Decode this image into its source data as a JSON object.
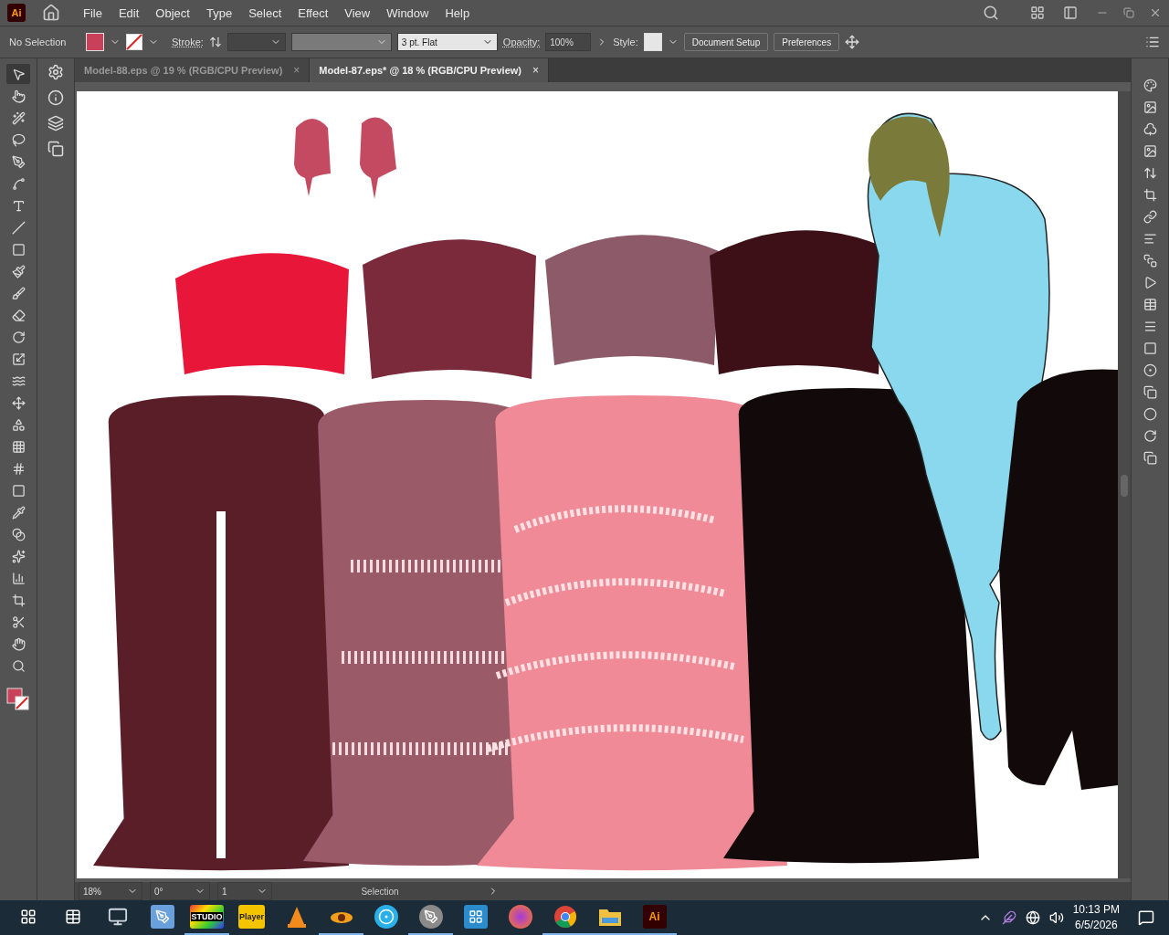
{
  "app": {
    "logo": "Ai"
  },
  "menu": [
    "File",
    "Edit",
    "Object",
    "Type",
    "Select",
    "Effect",
    "View",
    "Window",
    "Help"
  ],
  "control_bar": {
    "selection": "No Selection",
    "fill": {
      "color": "#c8405a"
    },
    "stroke_label": "Stroke:",
    "brush": "3 pt. Flat",
    "opacity_label": "Opacity:",
    "opacity": "100%",
    "style_label": "Style:",
    "buttons": [
      "Document Setup",
      "Preferences"
    ]
  },
  "tools": [
    {
      "kind": "select",
      "selected": true
    },
    {
      "kind": "direct",
      "selected": false
    },
    {
      "kind": "wand",
      "selected": false
    },
    {
      "kind": "lasso",
      "selected": false
    },
    {
      "kind": "pen",
      "selected": false
    },
    {
      "kind": "curve",
      "selected": false
    },
    {
      "kind": "type",
      "selected": false
    },
    {
      "kind": "line",
      "selected": false
    },
    {
      "kind": "rect",
      "selected": false
    },
    {
      "kind": "brush",
      "selected": false
    },
    {
      "kind": "blob",
      "selected": false
    },
    {
      "kind": "eraser",
      "selected": false
    },
    {
      "kind": "rotate",
      "selected": false
    },
    {
      "kind": "scale",
      "selected": false
    },
    {
      "kind": "warp",
      "selected": false
    },
    {
      "kind": "transform",
      "selected": false
    },
    {
      "kind": "shape",
      "selected": false
    },
    {
      "kind": "perspective",
      "selected": false
    },
    {
      "kind": "mesh",
      "selected": false
    },
    {
      "kind": "gradient",
      "selected": false
    },
    {
      "kind": "eyedropper",
      "selected": false
    },
    {
      "kind": "blend",
      "selected": false
    },
    {
      "kind": "symbol",
      "selected": false
    },
    {
      "kind": "graph",
      "selected": false
    },
    {
      "kind": "artboard",
      "selected": false
    },
    {
      "kind": "slice",
      "selected": false
    },
    {
      "kind": "hand",
      "selected": false
    },
    {
      "kind": "zoom",
      "selected": false
    }
  ],
  "tabs": [
    {
      "label": "Model-88.eps @ 19 % (RGB/CPU Preview)",
      "close": "×",
      "selected": false
    },
    {
      "label": "Model-87.eps* @ 18 % (RGB/CPU Preview)",
      "close": "×",
      "selected": true
    }
  ],
  "status_bar": {
    "zoom": "18%",
    "rotation": "0°",
    "artboard": "1",
    "tool": "Selection"
  },
  "taskbar": {
    "apps": [
      {
        "kind": "monitor",
        "open": false
      },
      {
        "kind": "tablet",
        "open": false
      },
      {
        "kind": "studio",
        "label": "STUDIO",
        "open": true
      },
      {
        "kind": "player",
        "label": "Player",
        "open": false
      },
      {
        "kind": "cone",
        "open": false
      },
      {
        "kind": "eye",
        "open": true
      },
      {
        "kind": "reel",
        "open": false
      },
      {
        "kind": "gimp",
        "open": true
      },
      {
        "kind": "maxthon",
        "open": false
      },
      {
        "kind": "firefox",
        "open": false
      },
      {
        "kind": "chrome",
        "open": true
      },
      {
        "kind": "folder",
        "open": true
      },
      {
        "kind": "illustrator",
        "label": "Ai",
        "open": true
      }
    ],
    "time": "10:13 PM",
    "date": "6/5/2026"
  }
}
